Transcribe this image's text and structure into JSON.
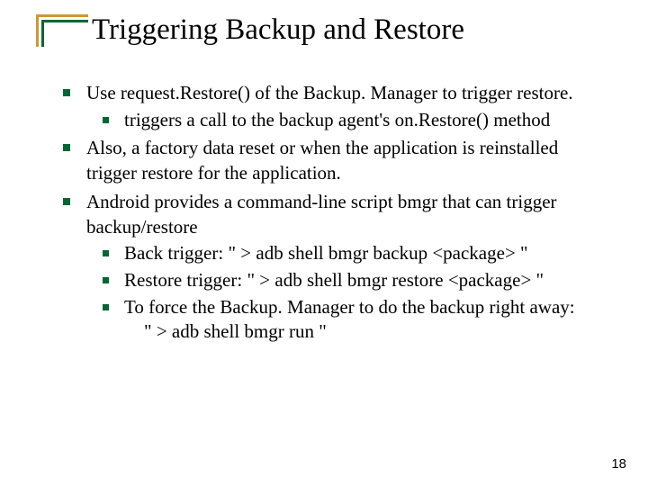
{
  "title": "Triggering Backup and Restore",
  "bullets": {
    "b1_pre": "Use  ",
    "b1_code": "request.Restore()",
    "b1_post": "  of the Backup. Manager to trigger restore.",
    "b1_1_pre": "triggers a call to the backup agent's ",
    "b1_1_code": "on.Restore()",
    "b1_1_post": " method",
    "b2": "Also, a factory data reset or when the application is reinstalled trigger restore for the application.",
    "b3_pre": "Android provides a command-line script  ",
    "b3_code": "bmgr",
    "b3_post": "  that can trigger backup/restore",
    "b3_1": "Back trigger: \" > adb shell bmgr backup <package> \"",
    "b3_2": "Restore trigger: \" > adb shell bmgr restore <package> \"",
    "b3_3": "To force the Backup. Manager to do the backup right away:",
    "b3_3b": "\"    > adb shell bmgr run \""
  },
  "page_number": "18"
}
